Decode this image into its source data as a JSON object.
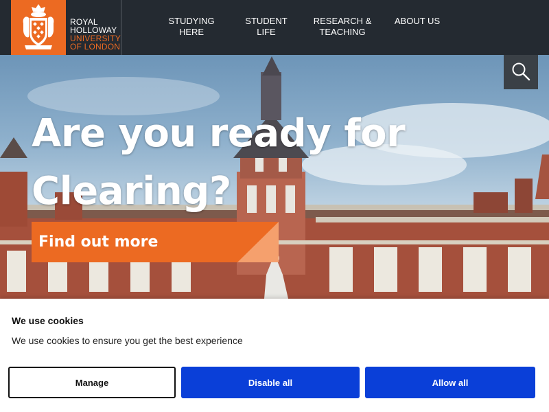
{
  "header": {
    "logo": {
      "line1": "ROYAL",
      "line2": "HOLLOWAY",
      "line3": "UNIVERSITY",
      "line4": "OF LONDON"
    },
    "nav": [
      {
        "line1": "STUDYING",
        "line2": "HERE"
      },
      {
        "line1": "STUDENT",
        "line2": "LIFE"
      },
      {
        "line1": "RESEARCH &",
        "line2": "TEACHING"
      },
      {
        "line1": "ABOUT US",
        "line2": ""
      }
    ]
  },
  "hero": {
    "title_line1": "Are you ready for",
    "title_line2": "Clearing?",
    "cta_label": "Find out more",
    "search_icon": "search-icon"
  },
  "cookie_banner": {
    "title": "We use cookies",
    "text": "We use cookies to ensure you get the best experience",
    "buttons": {
      "manage": "Manage",
      "disable": "Disable all",
      "allow": "Allow all"
    }
  },
  "colors": {
    "header_bg": "#242a31",
    "brand_orange": "#ec6a22",
    "button_blue": "#0a3fd8"
  }
}
